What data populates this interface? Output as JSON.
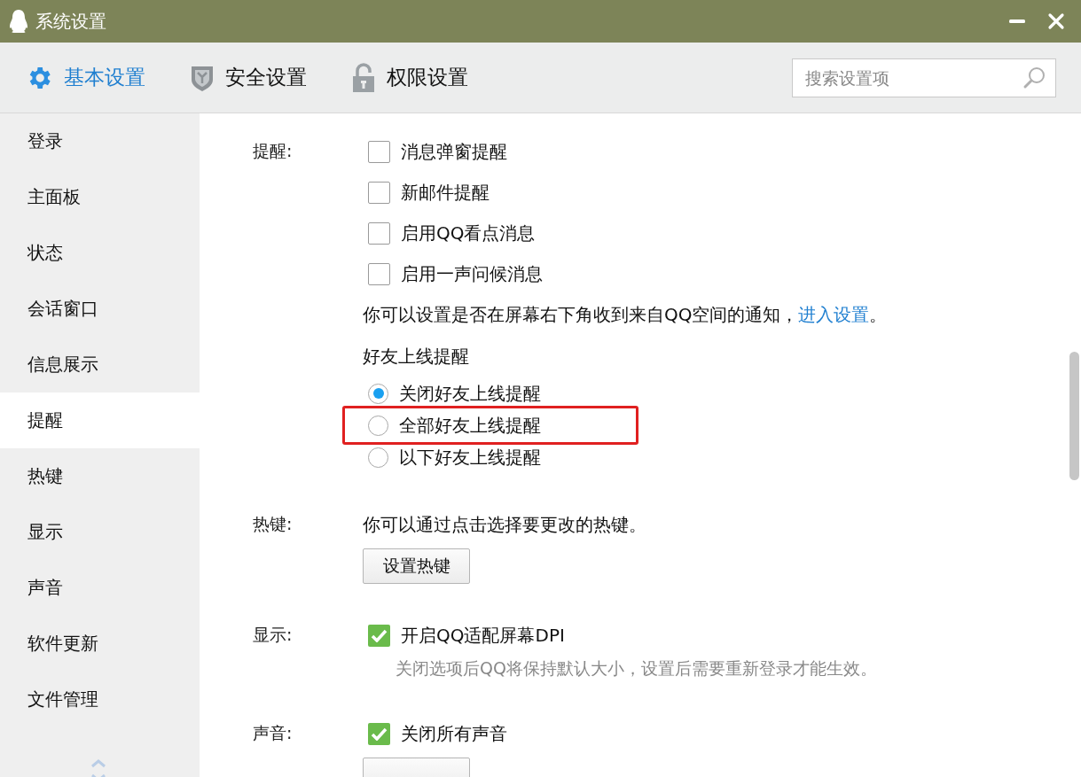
{
  "window": {
    "title": "系统设置"
  },
  "tabs": [
    {
      "label": "基本设置",
      "selected": true
    },
    {
      "label": "安全设置",
      "selected": false
    },
    {
      "label": "权限设置",
      "selected": false
    }
  ],
  "search": {
    "placeholder": "搜索设置项"
  },
  "sidebar": {
    "items": [
      {
        "label": "登录",
        "selected": false
      },
      {
        "label": "主面板",
        "selected": false
      },
      {
        "label": "状态",
        "selected": false
      },
      {
        "label": "会话窗口",
        "selected": false
      },
      {
        "label": "信息展示",
        "selected": false
      },
      {
        "label": "提醒",
        "selected": true
      },
      {
        "label": "热键",
        "selected": false
      },
      {
        "label": "显示",
        "selected": false
      },
      {
        "label": "声音",
        "selected": false
      },
      {
        "label": "软件更新",
        "selected": false
      },
      {
        "label": "文件管理",
        "selected": false
      }
    ]
  },
  "sections": [
    {
      "label": "提醒:",
      "items": [
        {
          "kind": "checkbox",
          "text": "消息弹窗提醒",
          "checked": false
        },
        {
          "kind": "checkbox",
          "text": "新邮件提醒",
          "checked": false
        },
        {
          "kind": "checkbox",
          "text": "启用QQ看点消息",
          "checked": false
        },
        {
          "kind": "checkbox",
          "text": "启用一声问候消息",
          "checked": false
        },
        {
          "kind": "note",
          "text": "你可以设置是否在屏幕右下角收到来自QQ空间的通知，",
          "link": "进入设置",
          "tail": "。"
        },
        {
          "kind": "heading",
          "text": "好友上线提醒"
        },
        {
          "kind": "radio",
          "text": "关闭好友上线提醒",
          "selected": true,
          "highlighted": false
        },
        {
          "kind": "radio",
          "text": "全部好友上线提醒",
          "selected": false,
          "highlighted": true
        },
        {
          "kind": "radio",
          "text": "以下好友上线提醒",
          "selected": false,
          "highlighted": false
        }
      ]
    },
    {
      "label": "热键:",
      "items": [
        {
          "kind": "note",
          "text": "你可以通过点击选择要更改的热键。"
        },
        {
          "kind": "button",
          "text": "设置热键"
        }
      ]
    },
    {
      "label": "显示:",
      "items": [
        {
          "kind": "checkbox",
          "text": "开启QQ适配屏幕DPI",
          "checked": true
        },
        {
          "kind": "hint",
          "text": "关闭选项后QQ将保持默认大小，设置后需要重新登录才能生效。"
        }
      ]
    },
    {
      "label": "声音:",
      "items": [
        {
          "kind": "checkbox",
          "text": "关闭所有声音",
          "checked": true
        },
        {
          "kind": "button"
        }
      ]
    }
  ]
}
